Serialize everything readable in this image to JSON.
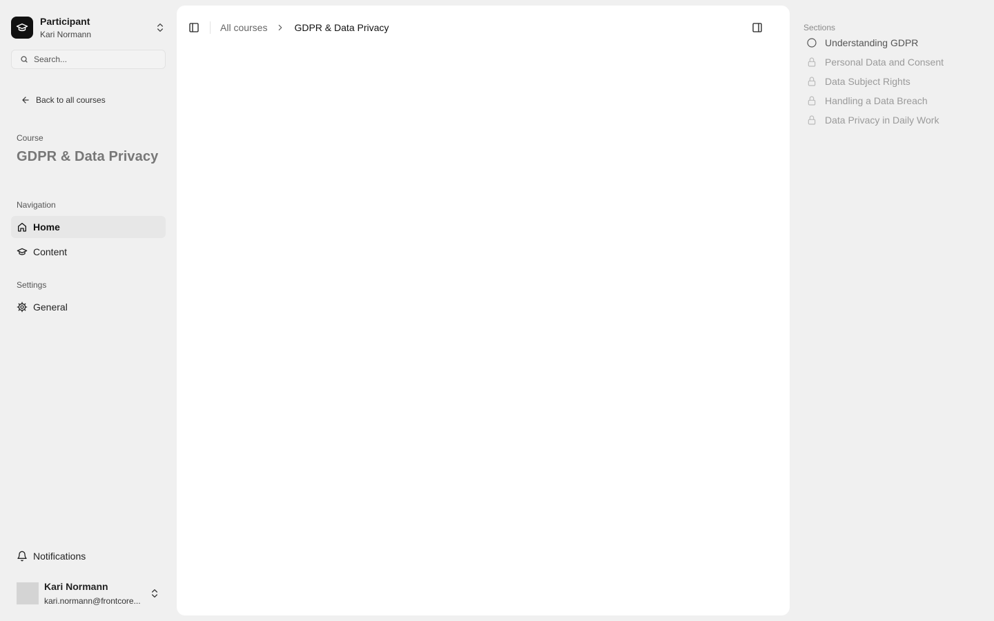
{
  "workspace": {
    "title": "Participant",
    "subtitle": "Kari Normann"
  },
  "search": {
    "placeholder": "Search..."
  },
  "back_link": "Back to all courses",
  "course": {
    "label": "Course",
    "title": "GDPR & Data Privacy"
  },
  "navigation": {
    "label": "Navigation",
    "items": [
      {
        "label": "Home",
        "icon": "home-icon",
        "active": true
      },
      {
        "label": "Content",
        "icon": "graduation-cap-icon",
        "active": false
      }
    ]
  },
  "settings": {
    "label": "Settings",
    "items": [
      {
        "label": "General",
        "icon": "gear-icon"
      }
    ]
  },
  "notifications": {
    "label": "Notifications",
    "icon": "bell-icon"
  },
  "user": {
    "name": "Kari Normann",
    "email": "kari.normann@frontcore..."
  },
  "breadcrumb": {
    "parent": "All courses",
    "current": "GDPR & Data Privacy"
  },
  "sections": {
    "label": "Sections",
    "items": [
      {
        "title": "Understanding GDPR",
        "state": "open",
        "icon": "circle-icon"
      },
      {
        "title": "Personal Data and Consent",
        "state": "locked",
        "icon": "lock-icon"
      },
      {
        "title": "Data Subject Rights",
        "state": "locked",
        "icon": "lock-icon"
      },
      {
        "title": "Handling a Data Breach",
        "state": "locked",
        "icon": "lock-icon"
      },
      {
        "title": "Data Privacy in Daily Work",
        "state": "locked",
        "icon": "lock-icon"
      }
    ]
  },
  "colors": {
    "background": "#f0f0f0",
    "panel": "#ffffff",
    "accent": "#111111",
    "muted": "#9a9a9a"
  }
}
